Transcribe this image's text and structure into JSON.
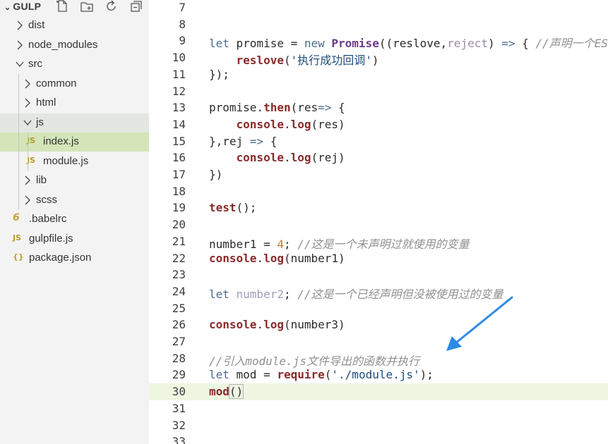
{
  "sidebar": {
    "title": "GULP",
    "items": [
      {
        "label": "dist",
        "kind": "folder",
        "expanded": false,
        "depth": 0
      },
      {
        "label": "node_modules",
        "kind": "folder",
        "expanded": false,
        "depth": 0
      },
      {
        "label": "src",
        "kind": "folder",
        "expanded": true,
        "depth": 0
      },
      {
        "label": "common",
        "kind": "folder",
        "expanded": false,
        "depth": 1
      },
      {
        "label": "html",
        "kind": "folder",
        "expanded": false,
        "depth": 1
      },
      {
        "label": "js",
        "kind": "folder",
        "expanded": true,
        "depth": 1
      },
      {
        "label": "index.js",
        "kind": "js",
        "depth": 2,
        "badge": "JS"
      },
      {
        "label": "module.js",
        "kind": "js",
        "depth": 2,
        "badge": "JS"
      },
      {
        "label": "lib",
        "kind": "folder",
        "expanded": false,
        "depth": 1
      },
      {
        "label": "scss",
        "kind": "folder",
        "expanded": false,
        "depth": 1
      },
      {
        "label": ".babelrc",
        "kind": "babel",
        "depth": 0,
        "badge": "6"
      },
      {
        "label": "gulpfile.js",
        "kind": "js",
        "depth": 0,
        "badge": "JS"
      },
      {
        "label": "package.json",
        "kind": "json",
        "depth": 0,
        "badge": "{}"
      }
    ]
  },
  "editor": {
    "lines": [
      {
        "n": "7",
        "parts": []
      },
      {
        "n": "8",
        "parts": []
      },
      {
        "n": "9",
        "parts": [
          [
            "kw",
            "let "
          ],
          [
            "",
            "promise = "
          ],
          [
            "kw",
            "new "
          ],
          [
            "cls",
            "Promise"
          ],
          [
            "",
            "(("
          ],
          [
            "",
            "reslove"
          ],
          [
            "",
            ","
          ],
          [
            "par",
            "reject"
          ],
          [
            "",
            ") "
          ],
          [
            "kw",
            "=>"
          ],
          [
            "",
            " { "
          ],
          [
            "cm",
            "//声明一个ES"
          ]
        ]
      },
      {
        "n": "10",
        "parts": [
          [
            "",
            "    "
          ],
          [
            "fn",
            "reslove"
          ],
          [
            "",
            "("
          ],
          [
            "str",
            "'执行成功回调'"
          ],
          [
            "",
            ")"
          ]
        ]
      },
      {
        "n": "11",
        "parts": [
          [
            "",
            "});"
          ]
        ]
      },
      {
        "n": "12",
        "parts": []
      },
      {
        "n": "13",
        "parts": [
          [
            "",
            "promise."
          ],
          [
            "fn",
            "then"
          ],
          [
            "",
            "(res"
          ],
          [
            "kw",
            "=>"
          ],
          [
            "",
            " {"
          ]
        ]
      },
      {
        "n": "14",
        "parts": [
          [
            "",
            "    "
          ],
          [
            "fn",
            "console"
          ],
          [
            "",
            "."
          ],
          [
            "fn",
            "log"
          ],
          [
            "",
            "(res)"
          ]
        ]
      },
      {
        "n": "15",
        "parts": [
          [
            "",
            "},rej "
          ],
          [
            "kw",
            "=>"
          ],
          [
            "",
            " {"
          ]
        ]
      },
      {
        "n": "16",
        "parts": [
          [
            "",
            "    "
          ],
          [
            "fn",
            "console"
          ],
          [
            "",
            "."
          ],
          [
            "fn",
            "log"
          ],
          [
            "",
            "(rej)"
          ]
        ]
      },
      {
        "n": "17",
        "parts": [
          [
            "",
            "})"
          ]
        ]
      },
      {
        "n": "18",
        "parts": []
      },
      {
        "n": "19",
        "parts": [
          [
            "fn",
            "test"
          ],
          [
            "",
            "();"
          ]
        ]
      },
      {
        "n": "20",
        "parts": []
      },
      {
        "n": "21",
        "parts": [
          [
            "",
            "number1 = "
          ],
          [
            "num",
            "4"
          ],
          [
            "",
            "; "
          ],
          [
            "cm",
            "//这是一个未声明过就使用的变量"
          ]
        ]
      },
      {
        "n": "22",
        "parts": [
          [
            "fn",
            "console"
          ],
          [
            "",
            "."
          ],
          [
            "fn",
            "log"
          ],
          [
            "",
            "(number1)"
          ]
        ]
      },
      {
        "n": "23",
        "parts": []
      },
      {
        "n": "24",
        "parts": [
          [
            "kw",
            "let "
          ],
          [
            "unused",
            "number2"
          ],
          [
            "",
            "; "
          ],
          [
            "cm",
            "//这是一个已经声明但没被使用过的变量"
          ]
        ]
      },
      {
        "n": "25",
        "parts": []
      },
      {
        "n": "26",
        "parts": [
          [
            "fn",
            "console"
          ],
          [
            "",
            "."
          ],
          [
            "fn",
            "log"
          ],
          [
            "",
            "(number3)"
          ]
        ]
      },
      {
        "n": "27",
        "parts": []
      },
      {
        "n": "28",
        "parts": [
          [
            "cm",
            "//引入module.js文件导出的函数并执行"
          ]
        ]
      },
      {
        "n": "29",
        "parts": [
          [
            "kw",
            "let "
          ],
          [
            "",
            "mod = "
          ],
          [
            "fn",
            "require"
          ],
          [
            "",
            "("
          ],
          [
            "str",
            "'./module.js'"
          ],
          [
            "",
            ");"
          ]
        ]
      },
      {
        "n": "30",
        "parts": [
          [
            "fn",
            "mod"
          ],
          [
            "bracket",
            "()"
          ]
        ],
        "current": true
      },
      {
        "n": "31",
        "parts": []
      },
      {
        "n": "32",
        "parts": []
      },
      {
        "n": "33",
        "parts": []
      }
    ]
  },
  "colors": {
    "sidebar_bg": "#f3f3f3",
    "selected_bg": "#d3e5b9",
    "current_line_bg": "#eef6e2",
    "arrow": "#2d8ae6"
  },
  "icons": [
    "new-file-icon",
    "new-folder-icon",
    "refresh-icon",
    "collapse-all-icon"
  ]
}
